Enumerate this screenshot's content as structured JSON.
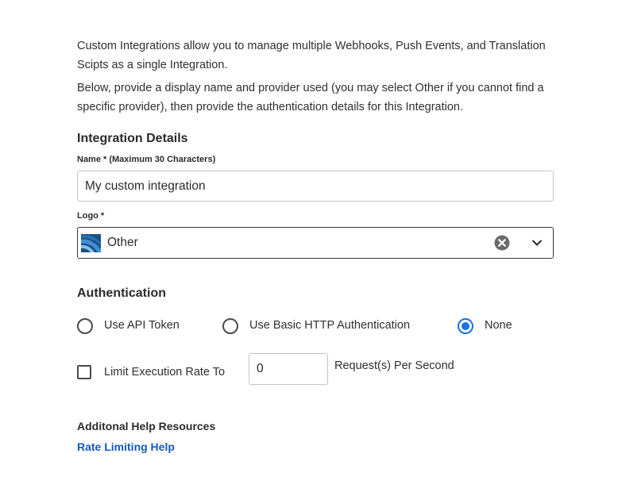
{
  "intro": {
    "paragraph1": "Custom Integrations allow you to manage multiple Webhooks, Push Events, and Translation Scipts as a single Integration.",
    "paragraph2": "Below, provide a display name and provider used (you may select Other if you cannot find a specific provider), then provide the authentication details for this Integration."
  },
  "integration_details": {
    "heading": "Integration Details",
    "name_label": "Name * (Maximum 30 Characters)",
    "name_value": "My custom integration",
    "logo_label": "Logo *",
    "logo_selected": "Other",
    "logo_icon": "other-provider-logo-icon"
  },
  "authentication": {
    "heading": "Authentication",
    "options": [
      {
        "label": "Use API Token",
        "checked": false
      },
      {
        "label": "Use Basic HTTP Authentication",
        "checked": false
      },
      {
        "label": "None",
        "checked": true
      }
    ],
    "accent_color": "#1a73e8",
    "rate_limit": {
      "label": "Limit Execution Rate To",
      "checked": false,
      "value": "0",
      "suffix": "Request(s) Per Second"
    }
  },
  "help": {
    "title": "Additonal Help Resources",
    "link_label": "Rate Limiting Help",
    "link_color": "#1558c0"
  }
}
